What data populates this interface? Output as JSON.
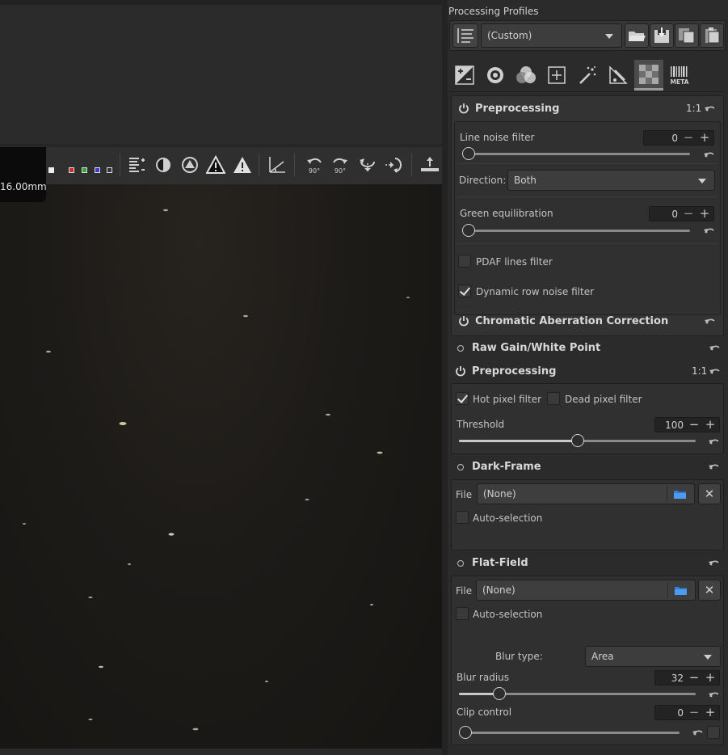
{
  "viewer": {
    "focal_length": "16.00mm",
    "toolbar_icons": [
      "channel-red-icon",
      "channel-green-icon",
      "channel-blue-icon",
      "channel-luminance-icon",
      "histogram-icon",
      "focus-mask-icon",
      "gamut-warning-icon",
      "clipped-shadows-icon",
      "clipped-highlights-icon",
      "straighten-icon",
      "rotate-left-icon",
      "rotate-right-icon",
      "flip-vertical-icon",
      "flip-horizontal-icon",
      "tool-upload-icon"
    ],
    "rotate_labels": [
      "90°",
      "90°"
    ]
  },
  "profiles": {
    "title": "Processing Profiles",
    "selected": "(Custom)"
  },
  "tabs": {
    "icons": [
      "exposure-icon",
      "detail-icon",
      "color-icon",
      "transform-icon",
      "effects-icon",
      "raw-icon",
      "raw-sensor-icon",
      "metadata-icon"
    ],
    "meta_label": "META"
  },
  "preprocessing_bayer": {
    "title": "Preprocessing",
    "ratio": "1:1",
    "line_noise_label": "Line noise filter",
    "line_noise_value": "0",
    "direction_label": "Direction:",
    "direction_value": "Both",
    "green_eq_label": "Green equilibration",
    "green_eq_value": "0",
    "pdaf_label": "PDAF lines filter",
    "pdaf_checked": false,
    "dynamic_row_label": "Dynamic row noise filter",
    "dynamic_row_checked": true
  },
  "chromatic": {
    "title": "Chromatic Aberration Correction"
  },
  "raw_gain": {
    "title": "Raw Gain/White Point"
  },
  "preprocessing": {
    "title": "Preprocessing",
    "ratio": "1:1",
    "hot_pixel_label": "Hot pixel filter",
    "hot_pixel_checked": true,
    "dead_pixel_label": "Dead pixel filter",
    "dead_pixel_checked": false,
    "threshold_label": "Threshold",
    "threshold_value": "100",
    "threshold_fraction": 0.5
  },
  "dark_frame": {
    "title": "Dark-Frame",
    "file_label": "File",
    "file_value": "(None)",
    "auto_label": "Auto-selection",
    "clear_label": "✕"
  },
  "flat_field": {
    "title": "Flat-Field",
    "file_label": "File",
    "file_value": "(None)",
    "auto_label": "Auto-selection",
    "clear_label": "✕",
    "blur_type_label": "Blur type:",
    "blur_type_value": "Area",
    "blur_radius_label": "Blur radius",
    "blur_radius_value": "32",
    "blur_radius_fraction": 0.17,
    "clip_label": "Clip control",
    "clip_value": "0",
    "spin_minus": "−",
    "spin_plus": "+"
  }
}
